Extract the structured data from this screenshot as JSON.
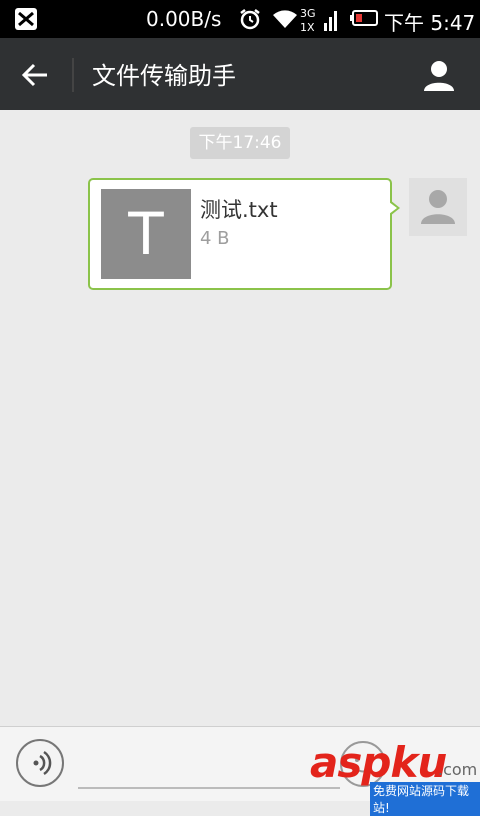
{
  "status_bar": {
    "net_speed": "0.00B/s",
    "network_type": "3G",
    "network_sub": "1X",
    "time": "下午 5:47"
  },
  "action_bar": {
    "title": "文件传输助手"
  },
  "chat": {
    "timestamp": "下午17:46",
    "message": {
      "thumb_letter": "T",
      "file_name": "测试.txt",
      "file_size": "4 B"
    }
  },
  "watermark": {
    "brand": "aspku",
    "tld": ".com",
    "sub": "免费网站源码下载站!"
  },
  "colors": {
    "accent_green": "#8bc34a",
    "actionbar": "#2f3133",
    "watermark_red": "#e3241b"
  },
  "icons": [
    "app-icon",
    "alarm-icon",
    "wifi-icon",
    "signal-icon",
    "battery-icon",
    "back-arrow-icon",
    "user-profile-icon",
    "avatar-icon",
    "voice-icon",
    "emoji-icon"
  ]
}
